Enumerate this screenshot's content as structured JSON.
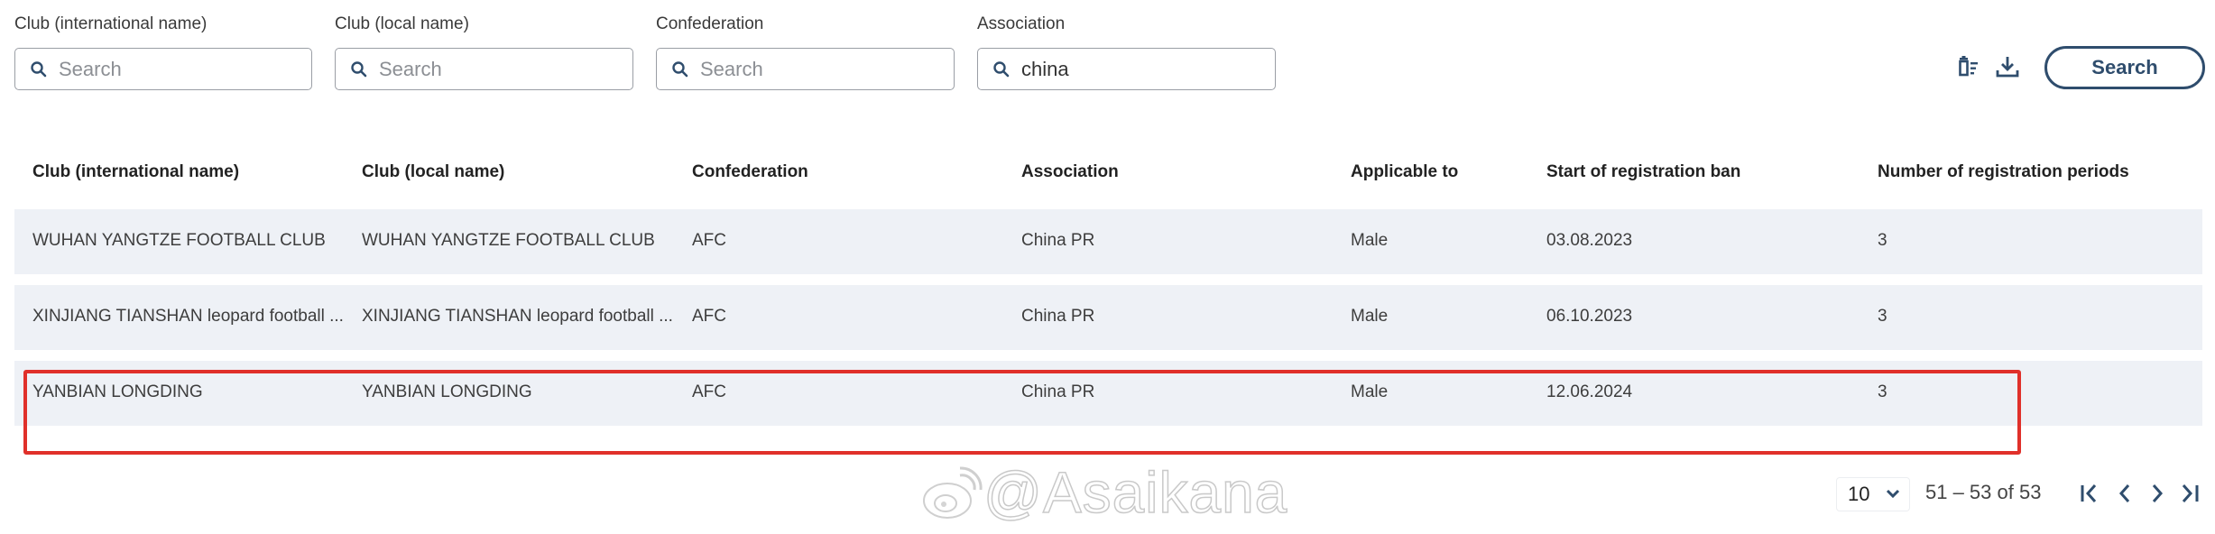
{
  "filters": [
    {
      "label": "Club (international name)",
      "placeholder": "Search",
      "value": ""
    },
    {
      "label": "Club (local name)",
      "placeholder": "Search",
      "value": ""
    },
    {
      "label": "Confederation",
      "placeholder": "Search",
      "value": ""
    },
    {
      "label": "Association",
      "placeholder": "Search",
      "value": "china"
    }
  ],
  "toolbar": {
    "clear_filters_icon": "clear-filter-icon",
    "download_icon": "download-icon",
    "search_label": "Search"
  },
  "table": {
    "columns": [
      "Club (international name)",
      "Club (local name)",
      "Confederation",
      "Association",
      "Applicable to",
      "Start of registration ban",
      "Number of registration periods"
    ],
    "rows": [
      [
        "WUHAN YANGTZE FOOTBALL CLUB",
        "WUHAN YANGTZE FOOTBALL CLUB",
        "AFC",
        "China PR",
        "Male",
        "03.08.2023",
        "3"
      ],
      [
        "XINJIANG TIANSHAN leopard football ...",
        "XINJIANG TIANSHAN leopard football ...",
        "AFC",
        "China PR",
        "Male",
        "06.10.2023",
        "3"
      ],
      [
        "YANBIAN LONGDING",
        "YANBIAN LONGDING",
        "AFC",
        "China PR",
        "Male",
        "12.06.2024",
        "3"
      ]
    ],
    "highlighted_row": 2
  },
  "pagination": {
    "page_size": "10",
    "range_text": "51 – 53 of 53"
  },
  "watermark": {
    "text": "@Asaikana",
    "icon": "weibo-icon"
  },
  "colors": {
    "accent": "#2f4d6d",
    "row_bg": "#eef1f6",
    "highlight": "#e0302a"
  }
}
